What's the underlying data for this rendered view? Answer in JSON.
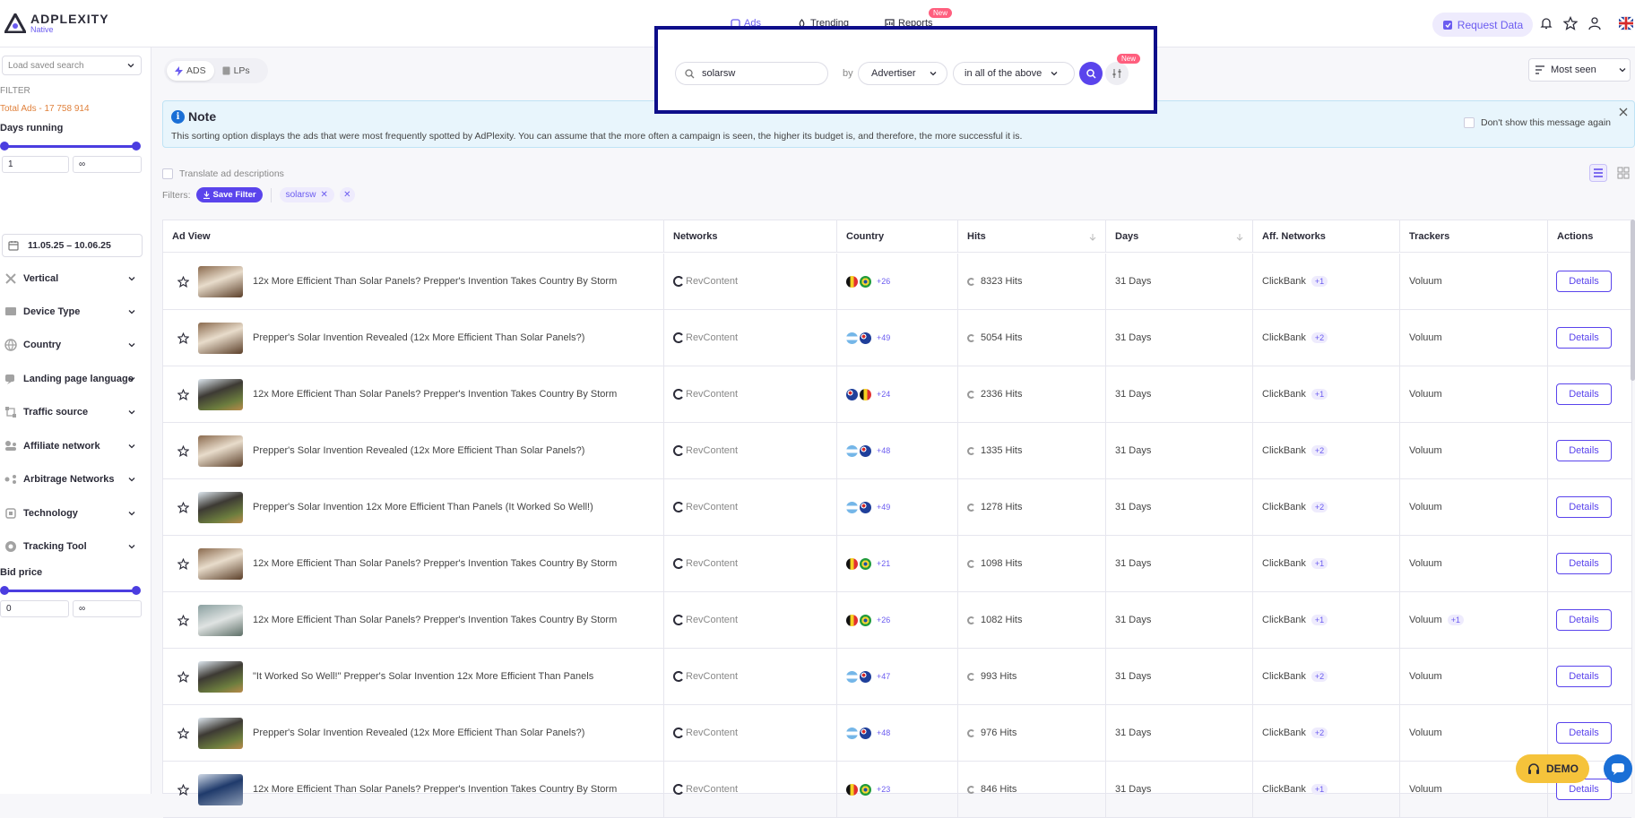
{
  "brand": {
    "name": "ADPLEXITY",
    "sub": "Native"
  },
  "nav": [
    {
      "label": "Ads",
      "icon": "ads-icon",
      "active": true
    },
    {
      "label": "Trending",
      "icon": "trending-icon",
      "active": false
    },
    {
      "label": "Reports",
      "icon": "reports-icon",
      "active": false,
      "badge": "New"
    }
  ],
  "header": {
    "request_label": "Request Data"
  },
  "sidebar": {
    "saved_placeholder": "Load saved search",
    "filter_label": "FILTER",
    "total_ads": "Total Ads - 17 758 914",
    "days_running_label": "Days running",
    "days_min": "1",
    "days_max": "∞",
    "date_range": "11.05.25 – 10.06.25",
    "items": [
      {
        "label": "Vertical",
        "icon": "vertical-icon"
      },
      {
        "label": "Device Type",
        "icon": "device-icon"
      },
      {
        "label": "Country",
        "icon": "globe-icon"
      },
      {
        "label": "Landing page language",
        "icon": "language-icon"
      },
      {
        "label": "Traffic source",
        "icon": "traffic-icon"
      },
      {
        "label": "Affiliate network",
        "icon": "affiliate-icon"
      },
      {
        "label": "Arbitrage Networks",
        "icon": "arbitrage-icon"
      },
      {
        "label": "Technology",
        "icon": "technology-icon"
      },
      {
        "label": "Tracking Tool",
        "icon": "tracking-icon"
      }
    ],
    "bid_label": "Bid price",
    "bid_min": "0",
    "bid_max": "∞"
  },
  "toolbar": {
    "ads_tab": "ADS",
    "lps_tab": "LPs",
    "sort_label": "Most seen"
  },
  "search": {
    "value": "solarsw",
    "by_label": "by",
    "field_select": "Advertiser",
    "scope_select": "in all of the above",
    "new_badge": "New"
  },
  "note": {
    "title": "Note",
    "body": "This sorting option displays the ads that were most frequently spotted by AdPlexity. You can assume that the more often a campaign is seen, the higher its budget is, and therefore, the more successful it is.",
    "dont_show": "Don't show this message again"
  },
  "translate_label": "Translate ad descriptions",
  "filters": {
    "label": "Filters:",
    "save_label": "Save Filter",
    "chips": [
      "solarsw"
    ]
  },
  "table": {
    "columns": [
      "Ad View",
      "Networks",
      "Country",
      "Hits",
      "Days",
      "Aff. Networks",
      "Trackers",
      "Actions"
    ],
    "rows": [
      {
        "title": "12x More Efficient Than Solar Panels? Prepper's Invention Takes Country By Storm",
        "network": "RevContent",
        "flags": [
          "be",
          "br"
        ],
        "country_more": "+26",
        "hits": "8323 Hits",
        "days": "31 Days",
        "aff": "ClickBank",
        "aff_more": "+1",
        "tracker": "Voluum",
        "tracker_more": "",
        "action": "Details",
        "thumb": "brown"
      },
      {
        "title": "Prepper's Solar Invention Revealed (12x More Efficient Than Solar Panels?)",
        "network": "RevContent",
        "flags": [
          "ar",
          "au"
        ],
        "country_more": "+49",
        "hits": "5054 Hits",
        "days": "31 Days",
        "aff": "ClickBank",
        "aff_more": "+2",
        "tracker": "Voluum",
        "tracker_more": "",
        "action": "Details",
        "thumb": "brown"
      },
      {
        "title": "12x More Efficient Than Solar Panels? Prepper's Invention Takes Country By Storm",
        "network": "RevContent",
        "flags": [
          "au",
          "be"
        ],
        "country_more": "+24",
        "hits": "2336 Hits",
        "days": "31 Days",
        "aff": "ClickBank",
        "aff_more": "+1",
        "tracker": "Voluum",
        "tracker_more": "",
        "action": "Details",
        "thumb": "green"
      },
      {
        "title": "Prepper's Solar Invention Revealed (12x More Efficient Than Solar Panels?)",
        "network": "RevContent",
        "flags": [
          "ar",
          "au"
        ],
        "country_more": "+48",
        "hits": "1335 Hits",
        "days": "31 Days",
        "aff": "ClickBank",
        "aff_more": "+2",
        "tracker": "Voluum",
        "tracker_more": "",
        "action": "Details",
        "thumb": "brown"
      },
      {
        "title": "Prepper's Solar Invention 12x More Efficient Than Panels (It Worked So Well!)",
        "network": "RevContent",
        "flags": [
          "ar",
          "au"
        ],
        "country_more": "+49",
        "hits": "1278 Hits",
        "days": "31 Days",
        "aff": "ClickBank",
        "aff_more": "+2",
        "tracker": "Voluum",
        "tracker_more": "",
        "action": "Details",
        "thumb": "green"
      },
      {
        "title": "12x More Efficient Than Solar Panels? Prepper's Invention Takes Country By Storm",
        "network": "RevContent",
        "flags": [
          "be",
          "br"
        ],
        "country_more": "+21",
        "hits": "1098 Hits",
        "days": "31 Days",
        "aff": "ClickBank",
        "aff_more": "+1",
        "tracker": "Voluum",
        "tracker_more": "",
        "action": "Details",
        "thumb": "brown"
      },
      {
        "title": "12x More Efficient Than Solar Panels? Prepper's Invention Takes Country By Storm",
        "network": "RevContent",
        "flags": [
          "be",
          "br"
        ],
        "country_more": "+26",
        "hits": "1082 Hits",
        "days": "31 Days",
        "aff": "ClickBank",
        "aff_more": "+1",
        "tracker": "Voluum",
        "tracker_more": "+1",
        "action": "Details",
        "thumb": "gray"
      },
      {
        "title": "\"It Worked So Well!\" Prepper's Solar Invention 12x More Efficient Than Panels",
        "network": "RevContent",
        "flags": [
          "ar",
          "au"
        ],
        "country_more": "+47",
        "hits": "993 Hits",
        "days": "31 Days",
        "aff": "ClickBank",
        "aff_more": "+2",
        "tracker": "Voluum",
        "tracker_more": "",
        "action": "Details",
        "thumb": "green"
      },
      {
        "title": "Prepper's Solar Invention Revealed (12x More Efficient Than Solar Panels?)",
        "network": "RevContent",
        "flags": [
          "ar",
          "au"
        ],
        "country_more": "+48",
        "hits": "976 Hits",
        "days": "31 Days",
        "aff": "ClickBank",
        "aff_more": "+2",
        "tracker": "Voluum",
        "tracker_more": "",
        "action": "Details",
        "thumb": "green"
      },
      {
        "title": "12x More Efficient Than Solar Panels? Prepper's Invention Takes Country By Storm",
        "network": "RevContent",
        "flags": [
          "be",
          "br"
        ],
        "country_more": "+23",
        "hits": "846 Hits",
        "days": "31 Days",
        "aff": "ClickBank",
        "aff_more": "+1",
        "tracker": "Voluum",
        "tracker_more": "",
        "action": "Details",
        "thumb": "blue"
      }
    ]
  },
  "demo_label": "DEMO",
  "colors": {
    "accent": "#5a44ec",
    "orange": "#e0813c",
    "note_bg": "#e8f5fc",
    "badge": "#ff5f7e"
  }
}
